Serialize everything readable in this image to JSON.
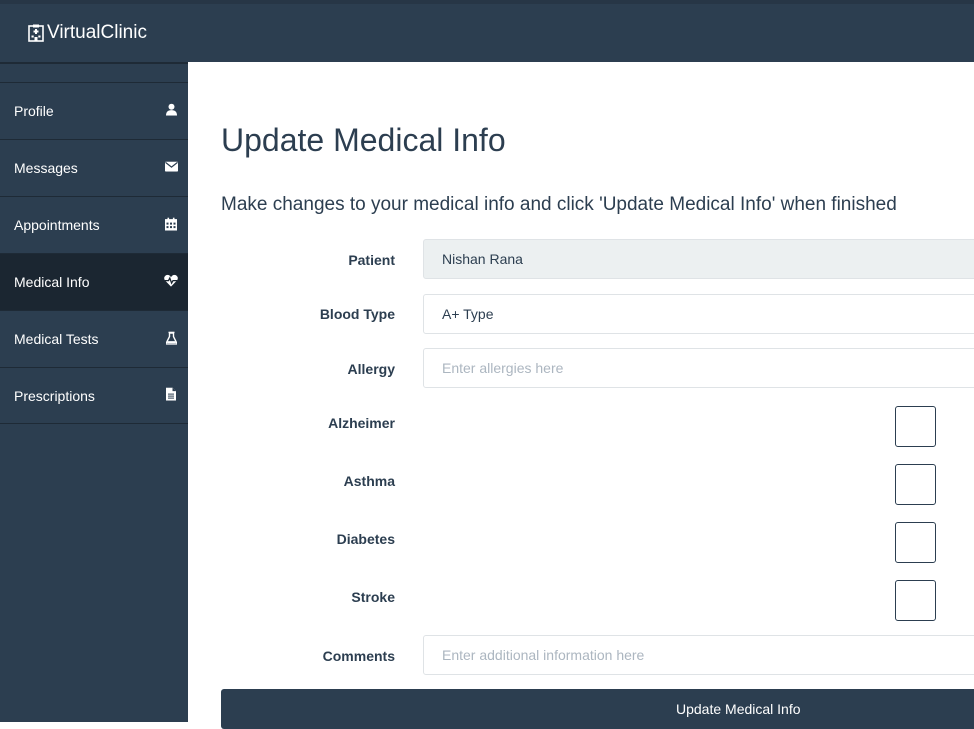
{
  "app": {
    "brand": "VirtualClinic"
  },
  "sidebar": {
    "items": [
      {
        "label": "Profile",
        "icon": "user-icon"
      },
      {
        "label": "Messages",
        "icon": "envelope-icon"
      },
      {
        "label": "Appointments",
        "icon": "calendar-icon"
      },
      {
        "label": "Medical Info",
        "icon": "heartbeat-icon",
        "active": true
      },
      {
        "label": "Medical Tests",
        "icon": "flask-icon"
      },
      {
        "label": "Prescriptions",
        "icon": "file-icon"
      }
    ]
  },
  "main": {
    "title": "Update Medical Info",
    "subtitle": "Make changes to your medical info and click 'Update Medical Info' when finished"
  },
  "form": {
    "patient": {
      "label": "Patient",
      "value": "Nishan Rana"
    },
    "blood_type": {
      "label": "Blood Type",
      "value": "A+ Type"
    },
    "allergy": {
      "label": "Allergy",
      "value": "",
      "placeholder": "Enter allergies here"
    },
    "alzheimer": {
      "label": "Alzheimer",
      "checked": false
    },
    "asthma": {
      "label": "Asthma",
      "checked": false
    },
    "diabetes": {
      "label": "Diabetes",
      "checked": false
    },
    "stroke": {
      "label": "Stroke",
      "checked": false
    },
    "comments": {
      "label": "Comments",
      "value": "",
      "placeholder": "Enter additional information here"
    },
    "submit_label": "Update Medical Info"
  },
  "colors": {
    "primary": "#2c3e50",
    "active": "#1b2631",
    "readonly_bg": "#ecf0f1"
  }
}
